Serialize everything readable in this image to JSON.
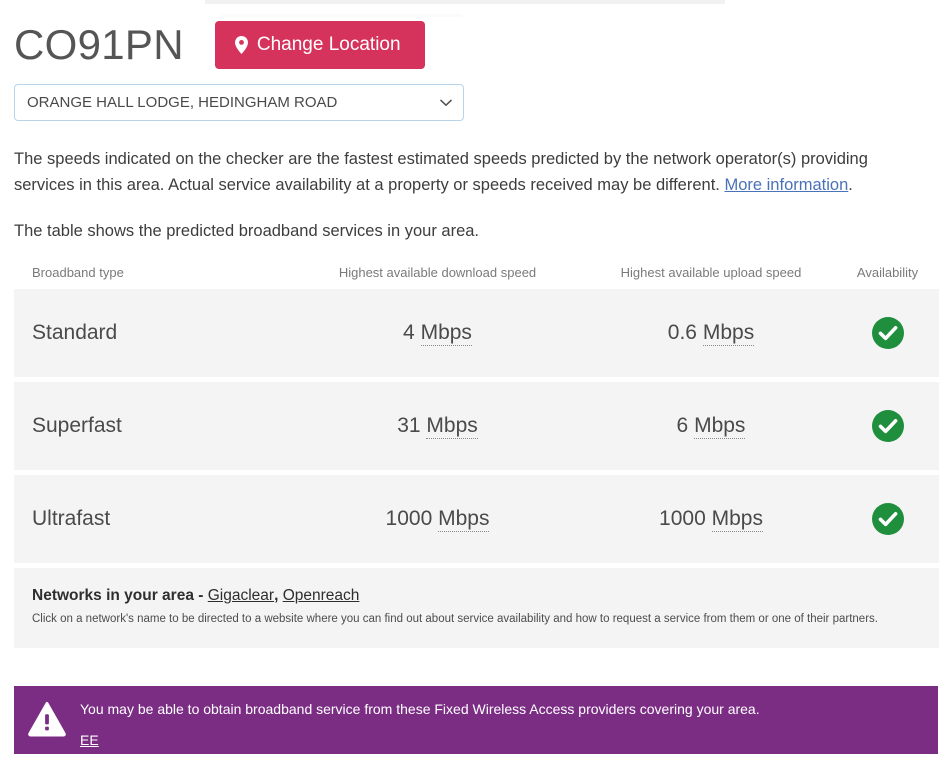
{
  "header": {
    "postcode": "CO91PN",
    "change_location_label": "Change Location",
    "pin_icon": "map-pin-icon"
  },
  "address_select": {
    "selected": "ORANGE HALL LODGE, HEDINGHAM ROAD",
    "options": [
      "ORANGE HALL LODGE, HEDINGHAM ROAD"
    ],
    "chevron_icon": "chevron-down-icon"
  },
  "intro": {
    "text_before_link": "The speeds indicated on the checker are the fastest estimated speeds predicted by the network operator(s) providing services in this area. Actual service availability at a property or speeds received may be different. ",
    "link_label": "More information",
    "text_after_link": ".",
    "table_intro": "The table shows the predicted broadband services in your area."
  },
  "table": {
    "headers": {
      "type": "Broadband type",
      "download": "Highest available download speed",
      "upload": "Highest available upload speed",
      "availability": "Availability"
    },
    "rows": [
      {
        "type": "Standard",
        "download_value": "4",
        "download_unit": "Mbps",
        "upload_value": "0.6",
        "upload_unit": "Mbps",
        "availability_icon": "check-circle-icon"
      },
      {
        "type": "Superfast",
        "download_value": "31",
        "download_unit": "Mbps",
        "upload_value": "6",
        "upload_unit": "Mbps",
        "availability_icon": "check-circle-icon"
      },
      {
        "type": "Ultrafast",
        "download_value": "1000",
        "download_unit": "Mbps",
        "upload_value": "1000",
        "upload_unit": "Mbps",
        "availability_icon": "check-circle-icon"
      }
    ]
  },
  "networks": {
    "title": "Networks in your area",
    "separator": " - ",
    "links": [
      "Gigaclear",
      "Openreach"
    ],
    "link_separator": ", ",
    "note": "Click on a network's name to be directed to a website where you can find out about service availability and how to request a service from them or one of their partners."
  },
  "alert": {
    "icon": "warning-triangle-icon",
    "message": "You may be able to obtain broadband service from these Fixed Wireless Access providers covering your area.",
    "link_label": "EE"
  },
  "colors": {
    "accent_pink": "#d6335c",
    "alert_purple": "#7b2d84",
    "success_green": "#1f8f3e",
    "link_blue": "#4a72b8",
    "row_grey": "#f4f4f4"
  }
}
